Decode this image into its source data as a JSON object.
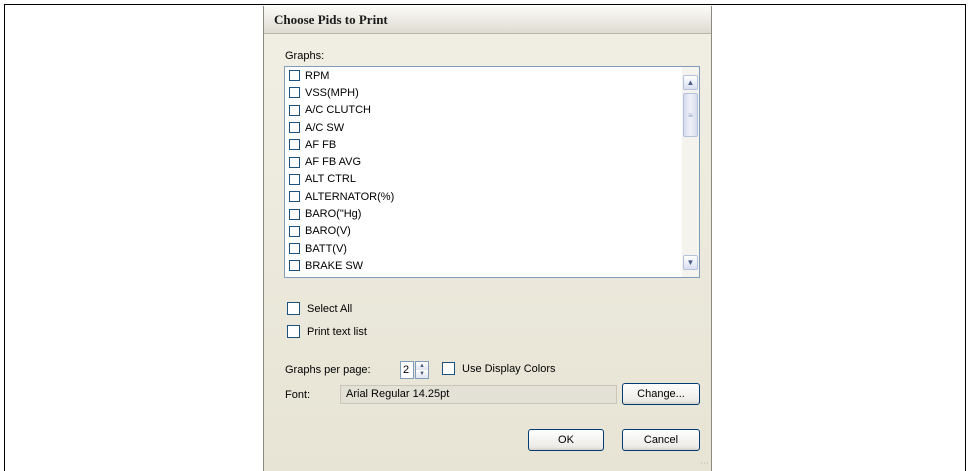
{
  "dialog": {
    "title": "Choose Pids to Print",
    "graphs_label": "Graphs:",
    "graph_items": [
      "RPM",
      "VSS(MPH)",
      "A/C CLUTCH",
      "A/C SW",
      "AF FB",
      "AF FB AVG",
      "ALT CTRL",
      "ALTERNATOR(%)",
      "BARO(\"Hg)",
      "BARO(V)",
      "BATT(V)",
      "BRAKE SW"
    ],
    "select_all_label": "Select All",
    "print_text_list_label": "Print text list",
    "graphs_per_page_label": "Graphs per page:",
    "graphs_per_page_value": "2",
    "use_display_colors_label": "Use Display Colors",
    "font_label": "Font:",
    "font_value": "Arial Regular 14.25pt",
    "change_button": "Change...",
    "ok_button": "OK",
    "cancel_button": "Cancel"
  },
  "icons": {
    "scroll_up": "chevron-up-icon",
    "scroll_down": "chevron-down-icon",
    "spin_up": "spin-up-icon",
    "spin_down": "spin-down-icon"
  },
  "colors": {
    "dialog_bg": "#ece9d8",
    "list_border": "#7f9db9",
    "button_border": "#003c74"
  }
}
